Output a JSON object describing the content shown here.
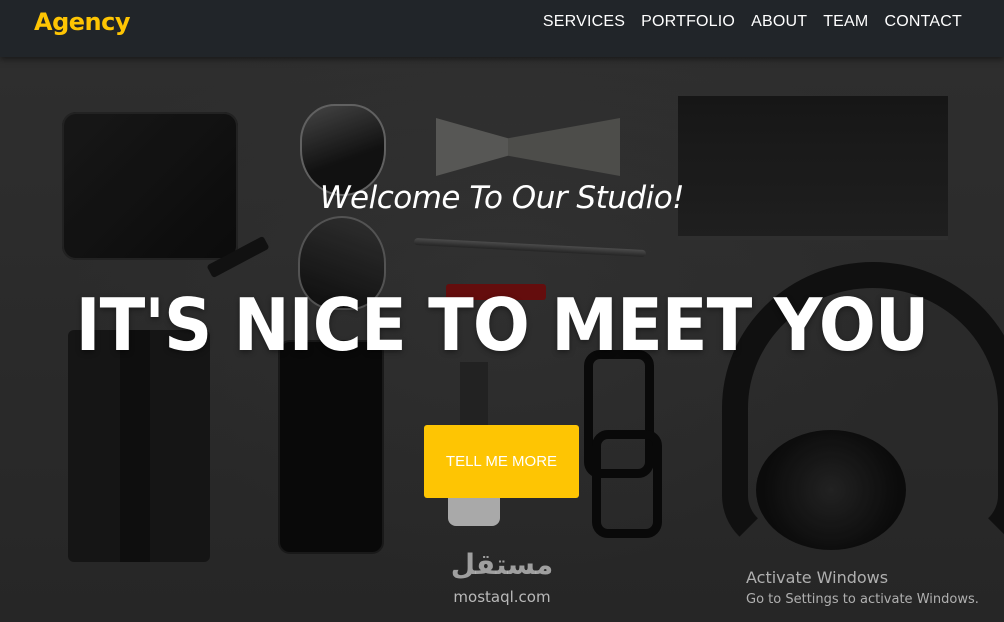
{
  "navbar": {
    "brand": "Agency",
    "links": [
      "SERVICES",
      "PORTFOLIO",
      "ABOUT",
      "TEAM",
      "CONTACT"
    ]
  },
  "hero": {
    "lead": "Welcome To Our Studio!",
    "heading": "IT'S NICE TO MEET YOU",
    "button_label": "TELL ME MORE"
  },
  "watermark": {
    "logo_text": "مستقل",
    "domain": "mostaql.com"
  },
  "windows_notice": {
    "title": "Activate Windows",
    "subtitle": "Go to Settings to activate Windows."
  },
  "colors": {
    "accent": "#fec503",
    "navbar_bg": "#212529",
    "text": "#ffffff"
  }
}
